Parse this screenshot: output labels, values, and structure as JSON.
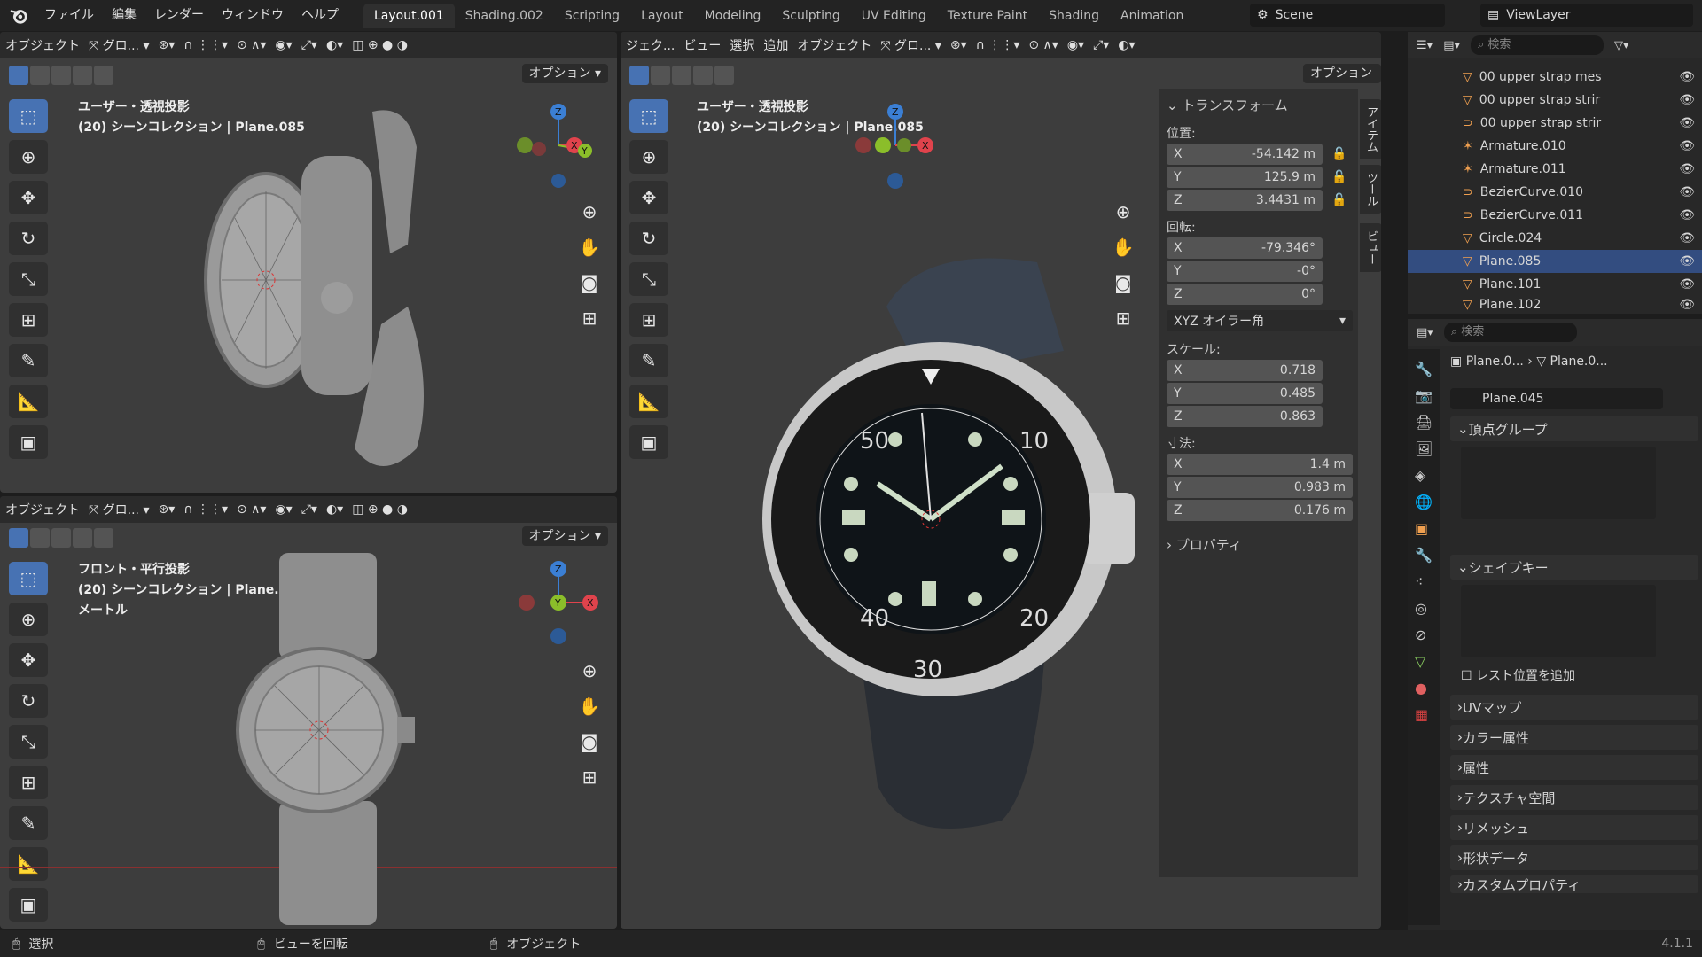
{
  "menu": [
    "ファイル",
    "編集",
    "レンダー",
    "ウィンドウ",
    "ヘルプ"
  ],
  "workspace_tabs": [
    {
      "label": "Layout.001",
      "active": true
    },
    {
      "label": "Shading.002"
    },
    {
      "label": "Scripting"
    },
    {
      "label": "Layout"
    },
    {
      "label": "Modeling"
    },
    {
      "label": "Sculpting"
    },
    {
      "label": "UV Editing"
    },
    {
      "label": "Texture Paint"
    },
    {
      "label": "Shading"
    },
    {
      "label": "Animation"
    }
  ],
  "scene": "Scene",
  "view_layer": "ViewLayer",
  "viewport_tl": {
    "mode": "オブジェクト",
    "transform": "グロ...",
    "options": "オプション",
    "view_name": "ユーザー・透視投影",
    "collection": "(20) シーンコレクション | Plane.085"
  },
  "viewport_bl": {
    "mode": "オブジェクト",
    "transform": "グロ...",
    "options": "オプション",
    "view_name": "フロント・平行投影",
    "collection": "(20) シーンコレクション | Plane.085",
    "unit": "メートル"
  },
  "viewport_main": {
    "mode": "ジェク...",
    "menus": [
      "ビュー",
      "選択",
      "追加",
      "オブジェクト"
    ],
    "transform": "グロ...",
    "options": "オプション",
    "view_name": "ユーザー・透視投影",
    "collection": "(20) シーンコレクション | Plane.085"
  },
  "transform_panel": {
    "title": "トランスフォーム",
    "location_label": "位置:",
    "location": {
      "x": "-54.142 m",
      "y": "125.9 m",
      "z": "3.4431 m"
    },
    "rotation_label": "回転:",
    "rotation": {
      "x": "-79.346°",
      "y": "-0°",
      "z": "0°"
    },
    "rotation_mode": "XYZ オイラー角",
    "scale_label": "スケール:",
    "scale": {
      "x": "0.718",
      "y": "0.485",
      "z": "0.863"
    },
    "dimensions_label": "寸法:",
    "dimensions": {
      "x": "1.4 m",
      "y": "0.983 m",
      "z": "0.176 m"
    },
    "properties": "プロパティ",
    "axis": {
      "x": "X",
      "y": "Y",
      "z": "Z"
    }
  },
  "sidebar_tabs": [
    "アイテム",
    "ツール",
    "ビュー"
  ],
  "outliner": {
    "search_placeholder": "検索",
    "items": [
      {
        "name": "00 upper strap mes",
        "type": "mesh"
      },
      {
        "name": "00 upper strap strir",
        "type": "mesh"
      },
      {
        "name": "00 upper strap strir",
        "type": "curve"
      },
      {
        "name": "Armature.010",
        "type": "armature"
      },
      {
        "name": "Armature.011",
        "type": "armature"
      },
      {
        "name": "BezierCurve.010",
        "type": "curve"
      },
      {
        "name": "BezierCurve.011",
        "type": "curve"
      },
      {
        "name": "Circle.024",
        "type": "mesh"
      },
      {
        "name": "Plane.085",
        "type": "mesh",
        "selected": true
      },
      {
        "name": "Plane.101",
        "type": "mesh"
      },
      {
        "name": "Plane.102",
        "type": "mesh"
      }
    ]
  },
  "properties": {
    "search_placeholder": "検索",
    "breadcrumb_object": "Plane.0...",
    "breadcrumb_data": "Plane.0...",
    "mesh_name": "Plane.045",
    "sections": [
      {
        "label": "頂点グループ",
        "open": true
      },
      {
        "label": "シェイプキー",
        "open": true
      },
      {
        "label": "UVマップ"
      },
      {
        "label": "カラー属性"
      },
      {
        "label": "属性"
      },
      {
        "label": "テクスチャ空間"
      },
      {
        "label": "リメッシュ"
      },
      {
        "label": "形状データ"
      },
      {
        "label": "カスタムプロパティ"
      }
    ],
    "rest_position": "レスト位置を追加"
  },
  "status": {
    "select": "選択",
    "rotate": "ビューを回転",
    "object": "オブジェクト",
    "version": "4.1.1"
  },
  "colors": {
    "accent": "#4772b3",
    "x_axis": "#e0434c",
    "y_axis": "#8bbe2a",
    "z_axis": "#3b7fd4",
    "bg": "#3d3d3d"
  }
}
